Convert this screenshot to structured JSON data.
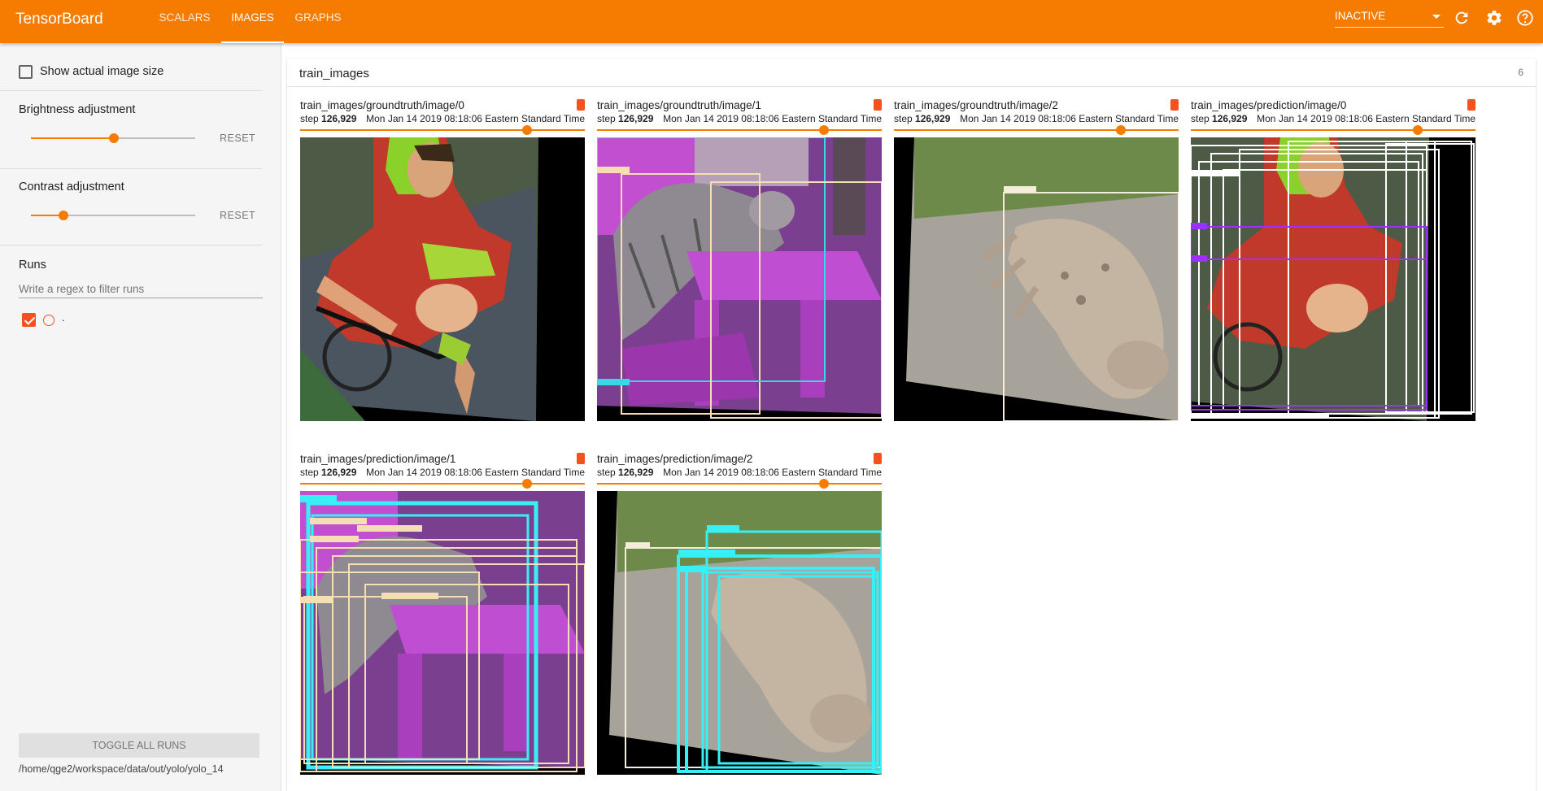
{
  "app": {
    "title": "TensorBoard",
    "tabs": [
      {
        "label": "SCALARS",
        "active": false
      },
      {
        "label": "IMAGES",
        "active": true
      },
      {
        "label": "GRAPHS",
        "active": false
      }
    ],
    "status": "INACTIVE",
    "accent_color": "#f57c00",
    "icons": [
      "chevron-down-icon",
      "refresh-icon",
      "settings-icon",
      "help-icon"
    ]
  },
  "sidebar": {
    "show_actual_size_label": "Show actual image size",
    "show_actual_size_checked": false,
    "brightness": {
      "label": "Brightness adjustment",
      "reset": "RESET",
      "value_fraction": 0.5
    },
    "contrast": {
      "label": "Contrast adjustment",
      "reset": "RESET",
      "value_fraction": 0.2
    },
    "runs": {
      "heading": "Runs",
      "filter_placeholder": "Write a regex to filter runs",
      "items": [
        {
          "label": ".",
          "checked": true,
          "color": "#f4511e"
        }
      ]
    },
    "toggle_all_label": "TOGGLE ALL RUNS",
    "logdir": "/home/qge2/workspace/data/out/yolo/yolo_14"
  },
  "card": {
    "title": "train_images",
    "count": "6",
    "images": [
      {
        "tag": "train_images/groundtruth/image/0",
        "step_prefix": "step",
        "step": "126,929",
        "timestamp": "Mon Jan 14 2019 08:18:06 Eastern Standard Time",
        "scene": "cyclist",
        "step_fraction": 0.78
      },
      {
        "tag": "train_images/groundtruth/image/1",
        "step_prefix": "step",
        "step": "126,929",
        "timestamp": "Mon Jan 14 2019 08:18:06 Eastern Standard Time",
        "scene": "cat-table",
        "step_fraction": 0.78
      },
      {
        "tag": "train_images/groundtruth/image/2",
        "step_prefix": "step",
        "step": "126,929",
        "timestamp": "Mon Jan 14 2019 08:18:06 Eastern Standard Time",
        "scene": "lying-dog",
        "step_fraction": 0.78
      },
      {
        "tag": "train_images/prediction/image/0",
        "step_prefix": "step",
        "step": "126,929",
        "timestamp": "Mon Jan 14 2019 08:18:06 Eastern Standard Time",
        "scene": "cyclist-boxes",
        "step_fraction": 0.78
      },
      {
        "tag": "train_images/prediction/image/1",
        "step_prefix": "step",
        "step": "126,929",
        "timestamp": "Mon Jan 14 2019 08:18:06 Eastern Standard Time",
        "scene": "cat-table-boxes",
        "step_fraction": 0.78
      },
      {
        "tag": "train_images/prediction/image/2",
        "step_prefix": "step",
        "step": "126,929",
        "timestamp": "Mon Jan 14 2019 08:18:06 Eastern Standard Time",
        "scene": "lying-dog-boxes",
        "step_fraction": 0.78
      }
    ]
  }
}
